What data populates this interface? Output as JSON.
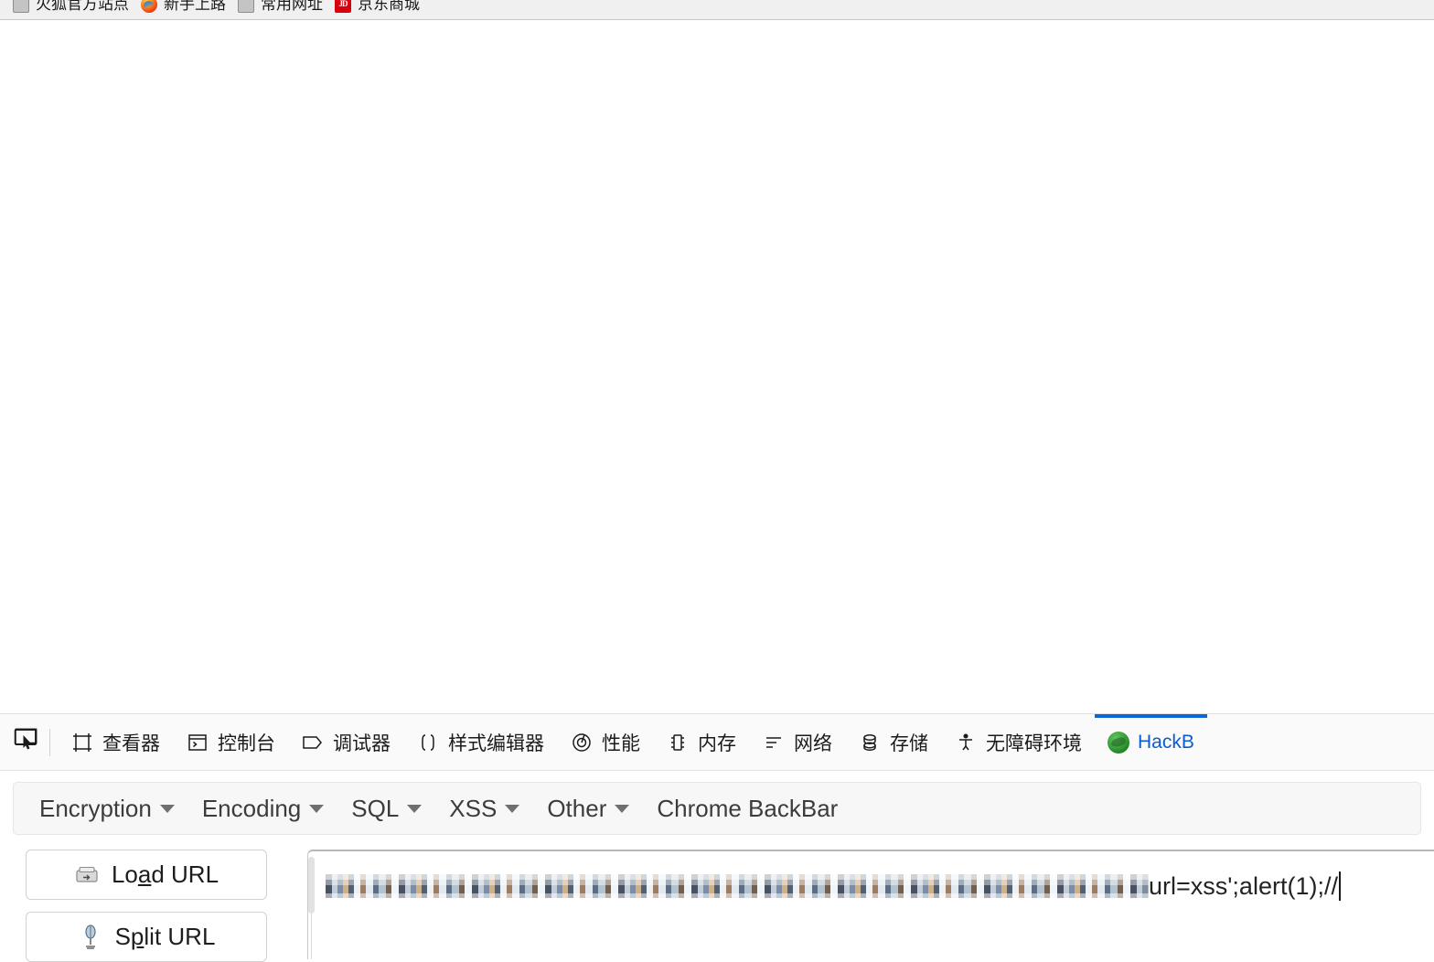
{
  "browser": {
    "bookmarks_bar": {
      "items": [
        {
          "label": "火狐官方站点",
          "icon": "generic-bookmark-icon"
        },
        {
          "label": "新手上路",
          "icon": "firefox-icon"
        },
        {
          "label": "常用网址",
          "icon": "generic-bookmark-icon"
        },
        {
          "label": "京东商城",
          "icon": "jd-logo-icon"
        }
      ]
    }
  },
  "devtools": {
    "picker_icon": "element-picker-icon",
    "tabs": [
      {
        "label": "查看器",
        "icon": "inspector-icon",
        "active": false
      },
      {
        "label": "控制台",
        "icon": "console-icon",
        "active": false
      },
      {
        "label": "调试器",
        "icon": "debugger-icon",
        "active": false
      },
      {
        "label": "样式编辑器",
        "icon": "style-editor-icon",
        "active": false
      },
      {
        "label": "性能",
        "icon": "performance-icon",
        "active": false
      },
      {
        "label": "内存",
        "icon": "memory-icon",
        "active": false
      },
      {
        "label": "网络",
        "icon": "network-icon",
        "active": false
      },
      {
        "label": "存储",
        "icon": "storage-icon",
        "active": false
      },
      {
        "label": "无障碍环境",
        "icon": "accessibility-icon",
        "active": false
      },
      {
        "label": "HackB",
        "icon": "hackbar-icon",
        "active": true
      }
    ],
    "active_tab_color": "#0a66db"
  },
  "hackbar": {
    "menu": [
      {
        "label": "Encryption",
        "has_caret": true
      },
      {
        "label": "Encoding",
        "has_caret": true
      },
      {
        "label": "SQL",
        "has_caret": true
      },
      {
        "label": "XSS",
        "has_caret": true
      },
      {
        "label": "Other",
        "has_caret": true
      },
      {
        "label": "Chrome BackBar",
        "has_caret": false
      }
    ],
    "buttons": [
      {
        "label_pre": "Lo",
        "label_accel": "a",
        "label_post": "d URL",
        "icon": "load-url-icon"
      },
      {
        "label_pre": "S",
        "label_accel": "p",
        "label_post": "lit URL",
        "icon": "split-url-icon"
      }
    ],
    "url_field": {
      "redacted_prefix": "",
      "visible_text": "url=xss';alert(1);//",
      "caret_visible": true
    }
  }
}
